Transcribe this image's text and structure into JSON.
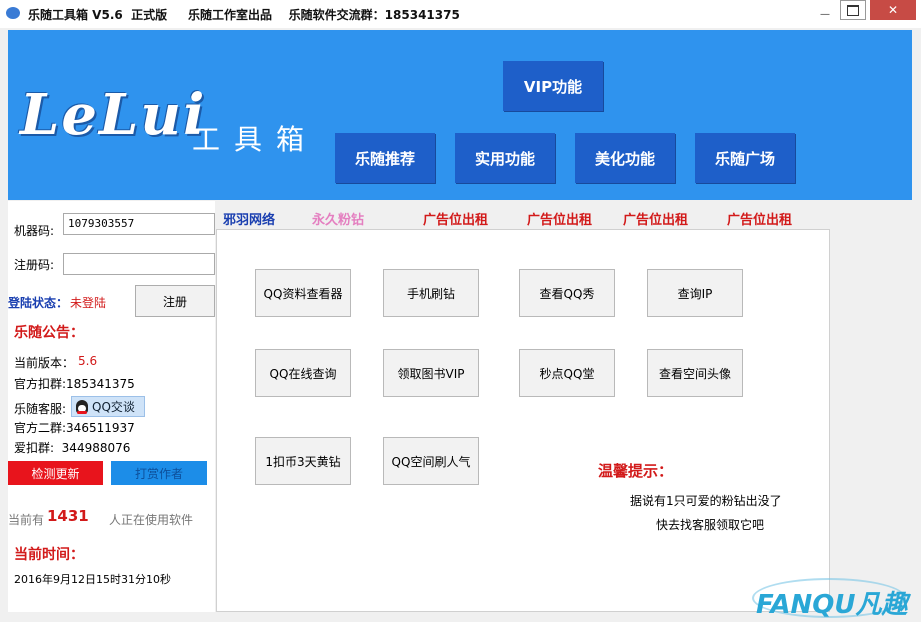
{
  "window": {
    "title": "乐随工具箱 V5.6  正式版     乐随工作室出品    乐随软件交流群：185341375",
    "close_glyph": "✕",
    "min_glyph": "—"
  },
  "header": {
    "logo_text": "LeLui",
    "logo_sub": "工具箱",
    "nav": {
      "vip": "VIP功能",
      "recommend": "乐随推荐",
      "practical": "实用功能",
      "beautify": "美化功能",
      "plaza": "乐随广场"
    }
  },
  "left": {
    "machine_label": "机器码:",
    "machine_value": "1079303557",
    "reg_label": "注册码:",
    "reg_value": "",
    "login_label": "登陆状态：",
    "login_value": "未登陆",
    "register_btn": "注册",
    "notice_title": "乐随公告：",
    "version_label": "当前版本：",
    "version_value": "5.6",
    "group1": "官方扣群:185341375",
    "service_label": "乐随客服:",
    "qq_talk": "QQ交谈",
    "group2": "官方二群:346511937",
    "love_group": "爱扣群:  344988076",
    "check_update": "检测更新",
    "donate": "打赏作者",
    "online_prefix": "当前有",
    "online_count": "1431",
    "online_suffix": "人正在使用软件",
    "time_title": "当前时间：",
    "time_value": "2016年9月12日15时31分10秒"
  },
  "ads": {
    "link1": "邪羽网络",
    "link2": "永久粉钻",
    "ad1": "广告位出租",
    "ad2": "广告位出租",
    "ad3": "广告位出租",
    "ad4": "广告位出租"
  },
  "functions": {
    "b1": "QQ资料查看器",
    "b2": "手机刷钻",
    "b3": "查看QQ秀",
    "b4": "查询IP",
    "b5": "QQ在线查询",
    "b6": "领取图书VIP",
    "b7": "秒点QQ堂",
    "b8": "查看空间头像",
    "b9": "1扣币3天黄钻",
    "b10": "QQ空间刷人气"
  },
  "tips": {
    "title": "温馨提示：",
    "line1": "据说有1只可爱的粉钻出没了",
    "line2": "快去找客服领取它吧"
  },
  "watermark": {
    "text": "FANQU凡趣"
  },
  "colors": {
    "header_bg": "#2f93ee",
    "nav_btn": "#1e5fc9",
    "red_button": "#e8141c",
    "blue_button": "#1c8de8",
    "accent_red": "#d21a1a",
    "ad_red": "#d21a1a",
    "link_blue": "#1a3fb0",
    "link_pink": "#e47fc0"
  }
}
